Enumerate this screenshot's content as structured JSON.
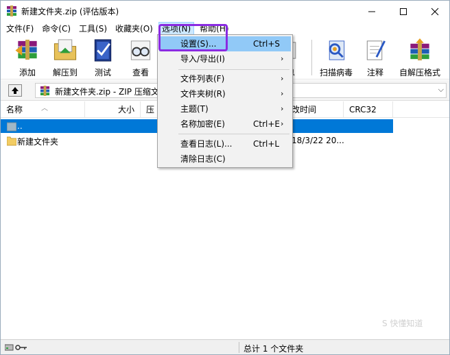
{
  "window": {
    "title": "新建文件夹.zip (评估版本)",
    "controls": {
      "minimize": "minimize",
      "maximize": "maximize",
      "close": "close"
    }
  },
  "menubar": [
    "文件(F)",
    "命令(C)",
    "工具(S)",
    "收藏夹(O)",
    "选项(N)",
    "帮助(H)"
  ],
  "toolbar": {
    "add": "添加",
    "extract": "解压到",
    "test": "测试",
    "view": "查看",
    "info_partial": "息",
    "scan": "扫描病毒",
    "comment": "注释",
    "sfx": "自解压格式"
  },
  "address": {
    "path": "新建文件夹.zip - ZIP 压缩文"
  },
  "columns": {
    "name": "名称",
    "size": "大小",
    "packed_partial": "压",
    "modified_partial": "改时间",
    "crc": "CRC32"
  },
  "files": [
    {
      "name": "..",
      "modified": ""
    },
    {
      "name": "新建文件夹",
      "modified": "18/3/22 20..."
    }
  ],
  "dropdown": {
    "items": [
      {
        "label": "设置(S)...",
        "shortcut": "Ctrl+S",
        "submenu": false
      },
      {
        "label": "导入/导出(I)",
        "shortcut": "",
        "submenu": true
      },
      {
        "label": "文件列表(F)",
        "shortcut": "",
        "submenu": true
      },
      {
        "label": "文件夹树(R)",
        "shortcut": "",
        "submenu": true
      },
      {
        "label": "主题(T)",
        "shortcut": "",
        "submenu": true
      },
      {
        "label": "名称加密(E)",
        "shortcut": "Ctrl+E",
        "submenu": true
      },
      {
        "label": "查看日志(L)...",
        "shortcut": "Ctrl+L",
        "submenu": false
      },
      {
        "label": "清除日志(C)",
        "shortcut": "",
        "submenu": false
      }
    ],
    "submenu_arrow": "›"
  },
  "status": {
    "text": "总计 1 个文件夹"
  },
  "watermark": "S 快懂知道",
  "colors": {
    "selection": "#0078d7",
    "menu_highlight": "#91c9f7",
    "annotation_box": "#8a2be2"
  }
}
